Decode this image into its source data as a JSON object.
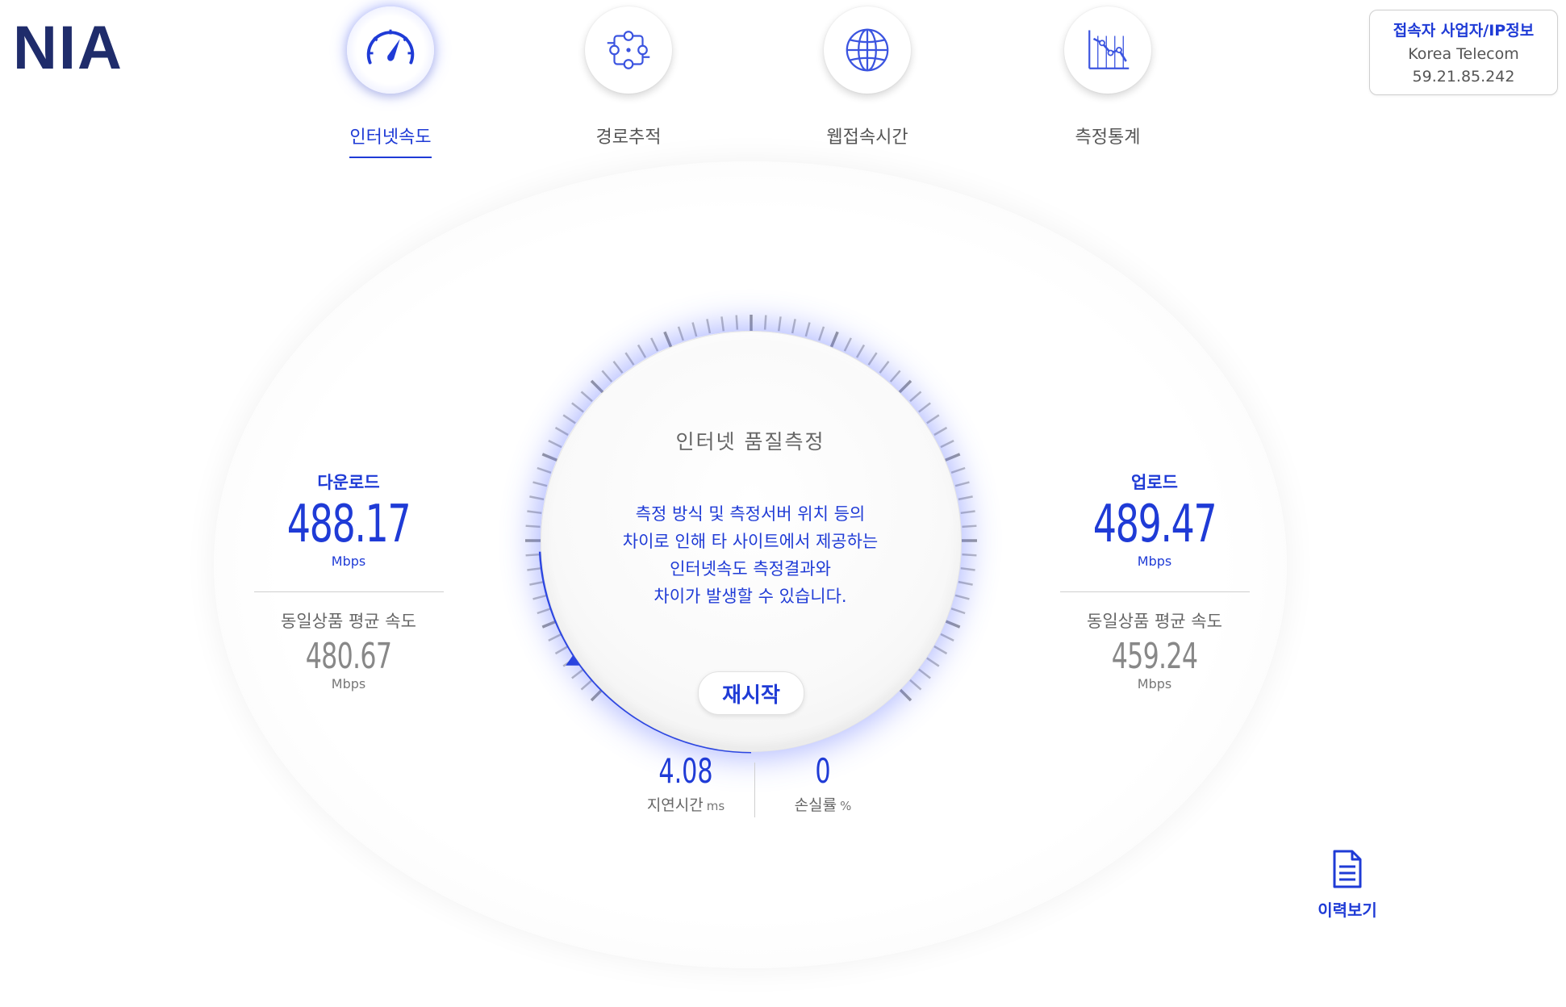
{
  "brand": {
    "logo_text": "NIA",
    "accent": "#1f3bd6",
    "logo_color": "#1f2c6b"
  },
  "nav": {
    "items": [
      {
        "label": "인터넷속도",
        "icon": "speedometer-icon",
        "active": true
      },
      {
        "label": "경로추적",
        "icon": "route-network-icon",
        "active": false
      },
      {
        "label": "웹접속시간",
        "icon": "globe-icon",
        "active": false
      },
      {
        "label": "측정통계",
        "icon": "statistics-chart-icon",
        "active": false
      }
    ]
  },
  "isp": {
    "title": "접속자 사업자/IP정보",
    "provider": "Korea Telecom",
    "ip": "59.21.85.242"
  },
  "gauge": {
    "title": "인터넷 품질측정",
    "notice": [
      "측정 방식 및 측정서버 위치 등의",
      "차이로 인해 타 사이트에서 제공하는",
      "인터넷속도 측정결과와",
      "차이가 발생할 수 있습니다."
    ],
    "restart_label": "재시작"
  },
  "download": {
    "title": "다운로드",
    "value": "488.17",
    "unit": "Mbps",
    "avg_title": "동일상품 평균 속도",
    "avg_value": "480.67",
    "avg_unit": "Mbps"
  },
  "upload": {
    "title": "업로드",
    "value": "489.47",
    "unit": "Mbps",
    "avg_title": "동일상품 평균 속도",
    "avg_value": "459.24",
    "avg_unit": "Mbps"
  },
  "latency": {
    "value": "4.08",
    "label": "지연시간",
    "unit": "ms"
  },
  "loss": {
    "value": "0",
    "label": "손실률",
    "unit": "%"
  },
  "history": {
    "label": "이력보기",
    "icon": "document-icon"
  }
}
